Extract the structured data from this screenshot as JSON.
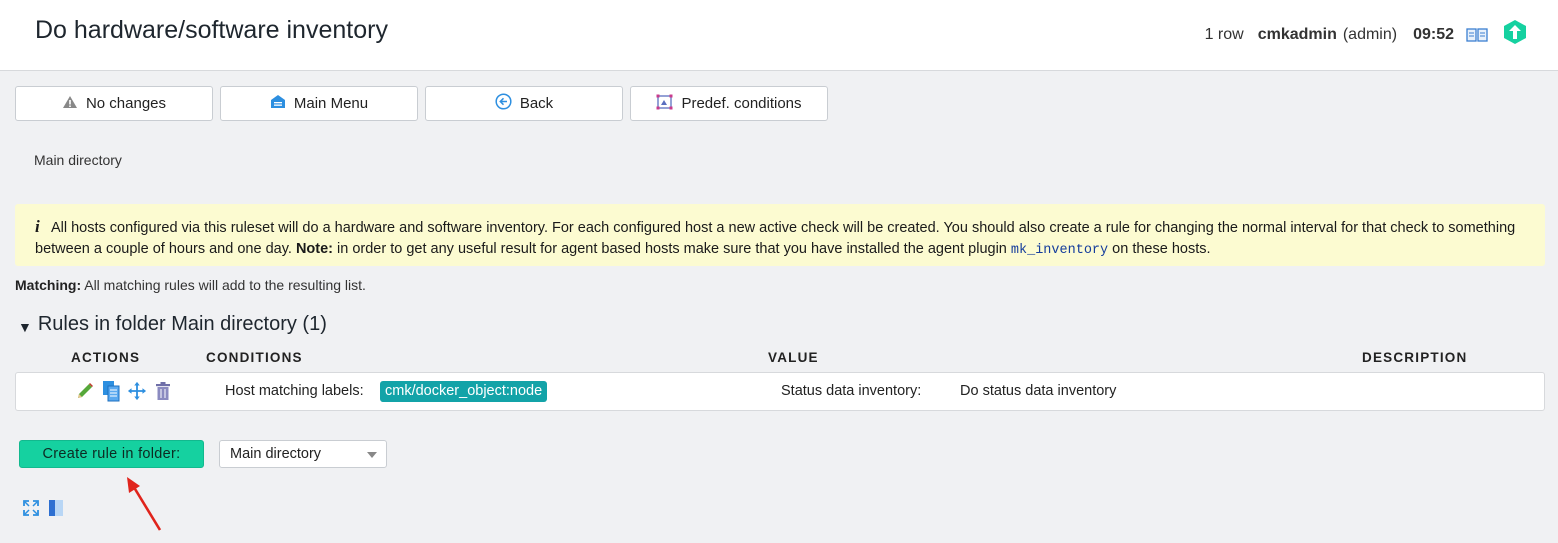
{
  "header": {
    "title": "Do hardware/software inventory",
    "row_count": "1 row",
    "user": "cmkadmin",
    "role": "(admin)",
    "time": "09:52"
  },
  "toolbar": {
    "no_changes": "No changes",
    "main_menu": "Main Menu",
    "back": "Back",
    "predef_conditions": "Predef. conditions"
  },
  "breadcrumb": "Main directory",
  "help": {
    "text1": "All hosts configured via this ruleset will do a hardware and software inventory. For each configured host a new active check will be created. You should also create a rule for changing the normal interval for that check to something between a couple of hours and one day.",
    "note_label": "Note:",
    "text2": "in order to get any useful result for agent based hosts make sure that you have installed the agent plugin",
    "plugin": "mk_inventory",
    "text3": "on these hosts."
  },
  "matching": {
    "label": "Matching:",
    "text": "All matching rules will add to the resulting list."
  },
  "folder": {
    "title": "Rules in folder Main directory (1)"
  },
  "table": {
    "columns": [
      "ACTIONS",
      "CONDITIONS",
      "VALUE",
      "DESCRIPTION"
    ],
    "rows": [
      {
        "condition_label": "Host matching labels:",
        "condition_tag": "cmk/docker_object:node",
        "value_label": "Status data inventory:",
        "value_text": "Do status data inventory",
        "description": ""
      }
    ]
  },
  "create": {
    "button_label": "Create rule in folder:",
    "folder_select": "Main directory"
  },
  "colors": {
    "accent_green": "#15d1a0",
    "tag_teal": "#13a3a8",
    "help_bg": "#fcfbd1"
  }
}
